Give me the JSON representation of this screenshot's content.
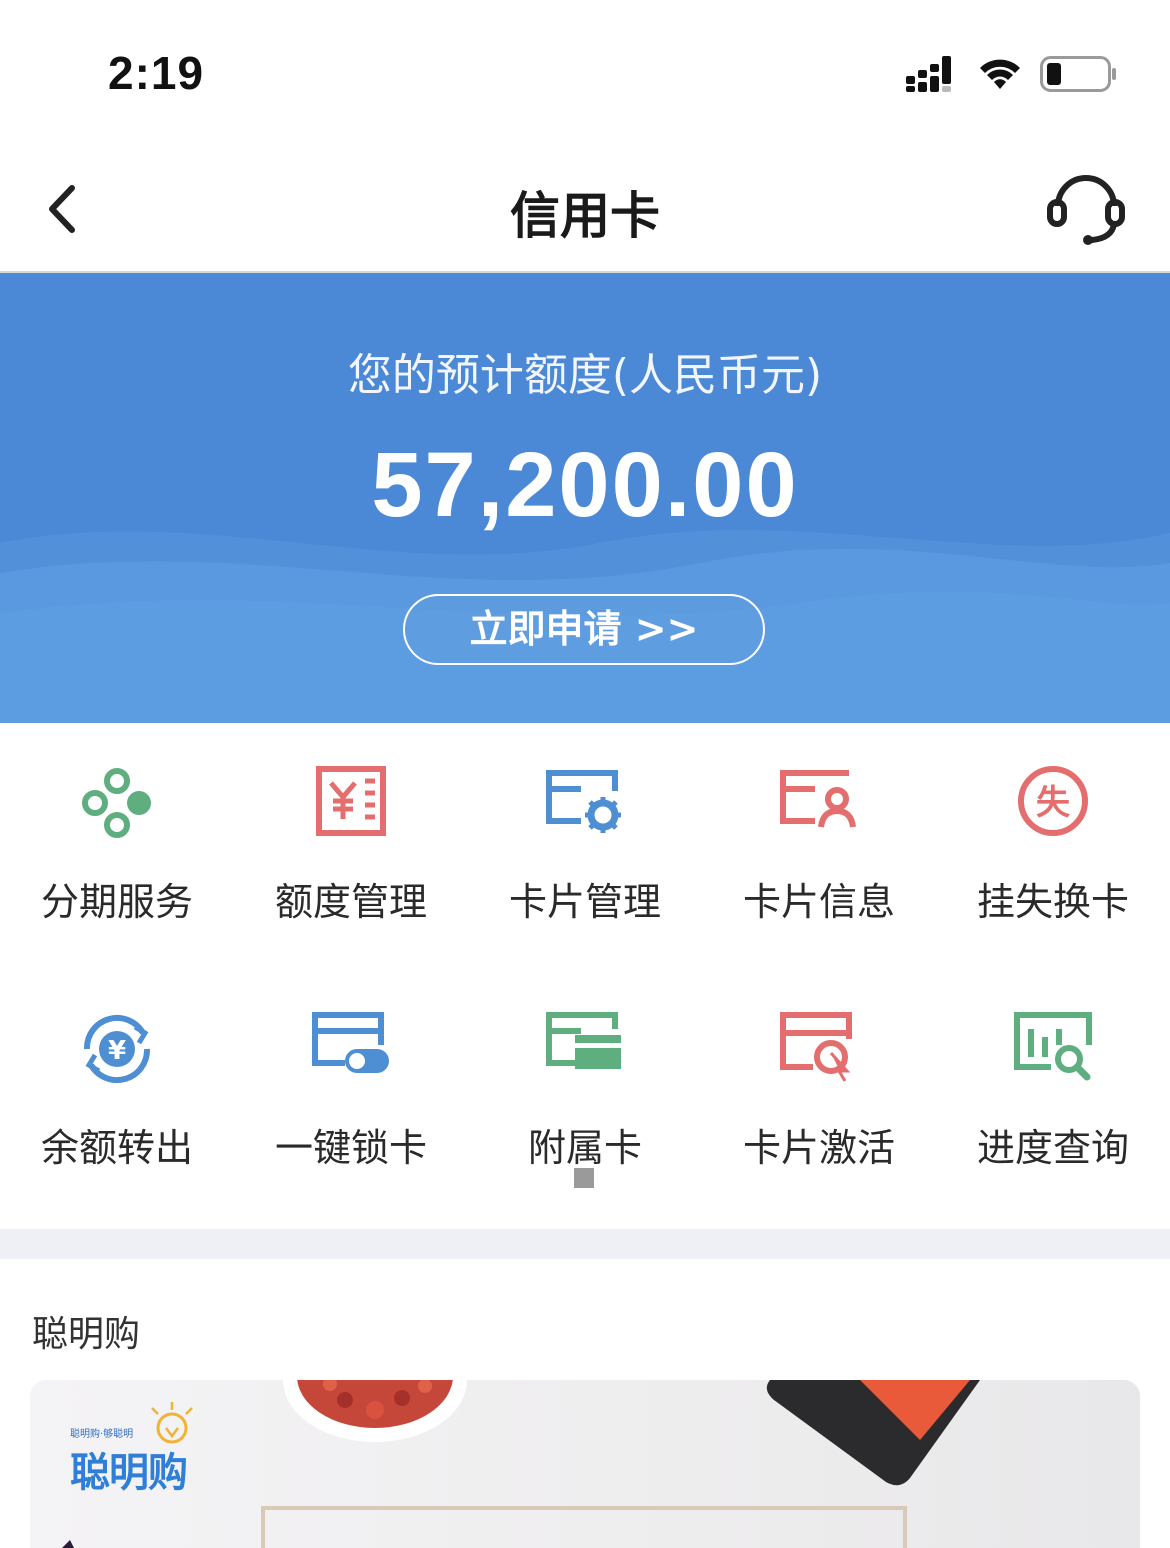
{
  "status_bar": {
    "time": "2:19"
  },
  "nav": {
    "title": "信用卡"
  },
  "banner": {
    "label": "您的预计额度(人民币元)",
    "amount": "57,200.00",
    "apply_label": "立即申请 >>"
  },
  "grid": {
    "items": [
      {
        "label": "分期服务",
        "icon": "installment-icon",
        "color": "#5fae7f"
      },
      {
        "label": "额度管理",
        "icon": "credit-limit-icon",
        "color": "#e46d6d"
      },
      {
        "label": "卡片管理",
        "icon": "card-settings-icon",
        "color": "#4e8fd4"
      },
      {
        "label": "卡片信息",
        "icon": "card-info-icon",
        "color": "#e46d6d"
      },
      {
        "label": "挂失换卡",
        "icon": "report-loss-icon",
        "color": "#e46d6d"
      },
      {
        "label": "余额转出",
        "icon": "balance-transfer-icon",
        "color": "#4e8fd4"
      },
      {
        "label": "一键锁卡",
        "icon": "card-lock-icon",
        "color": "#4e8fd4"
      },
      {
        "label": "附属卡",
        "icon": "supplementary-card-icon",
        "color": "#5fae7f"
      },
      {
        "label": "卡片激活",
        "icon": "card-activate-icon",
        "color": "#e46d6d"
      },
      {
        "label": "进度查询",
        "icon": "progress-query-icon",
        "color": "#5fae7f"
      }
    ]
  },
  "section": {
    "title": "聪明购"
  },
  "promo": {
    "logo_small": "聪明购·够聪明",
    "logo": "聪明购"
  },
  "colors": {
    "banner": "#4b89d6",
    "green": "#5fae7f",
    "red": "#e46d6d",
    "blue": "#4e8fd4"
  }
}
